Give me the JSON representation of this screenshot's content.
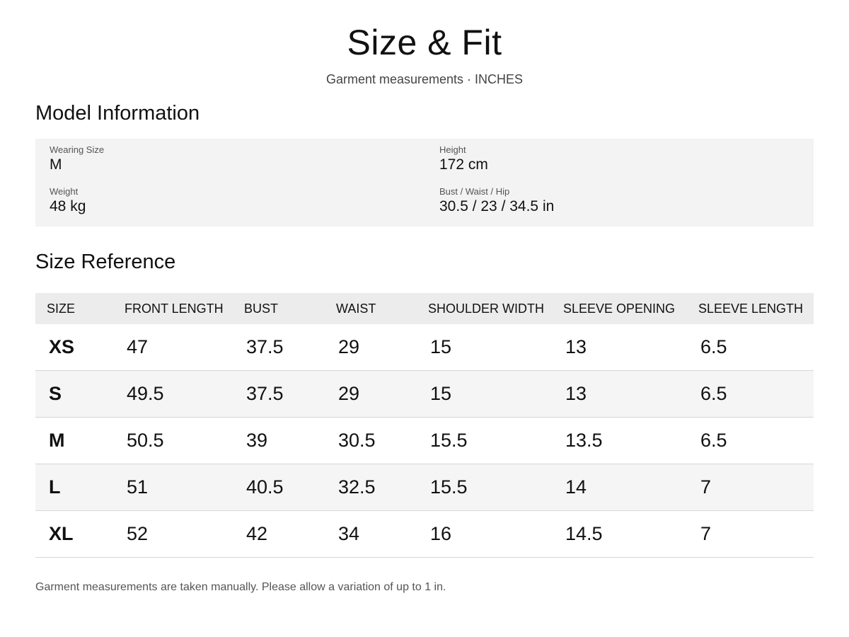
{
  "header": {
    "title": "Size & Fit",
    "subtitle": "Garment measurements · INCHES"
  },
  "model": {
    "heading": "Model Information",
    "wearing_size": {
      "label": "Wearing Size",
      "value": "M"
    },
    "height": {
      "label": "Height",
      "value": "172 cm"
    },
    "weight": {
      "label": "Weight",
      "value": "48 kg"
    },
    "bust_waist_hip": {
      "label": "Bust / Waist / Hip",
      "value": "30.5 / 23 / 34.5 in"
    }
  },
  "size_reference": {
    "heading": "Size Reference",
    "columns": [
      "SIZE",
      "FRONT LENGTH",
      "BUST",
      "WAIST",
      "SHOULDER WIDTH",
      "SLEEVE OPENING",
      "SLEEVE LENGTH"
    ],
    "rows": [
      [
        "XS",
        "47",
        "37.5",
        "29",
        "15",
        "13",
        "6.5"
      ],
      [
        "S",
        "49.5",
        "37.5",
        "29",
        "15",
        "13",
        "6.5"
      ],
      [
        "M",
        "50.5",
        "39",
        "30.5",
        "15.5",
        "13.5",
        "6.5"
      ],
      [
        "L",
        "51",
        "40.5",
        "32.5",
        "15.5",
        "14",
        "7"
      ],
      [
        "XL",
        "52",
        "42",
        "34",
        "16",
        "14.5",
        "7"
      ]
    ]
  },
  "note": "Garment measurements are taken manually. Please allow a variation of up to 1 in.",
  "colors": {
    "panel_background": "#f3f3f3",
    "table_header_background": "#ececec",
    "striped_row_background": "#f5f5f5",
    "row_divider": "#d6d6d6"
  }
}
